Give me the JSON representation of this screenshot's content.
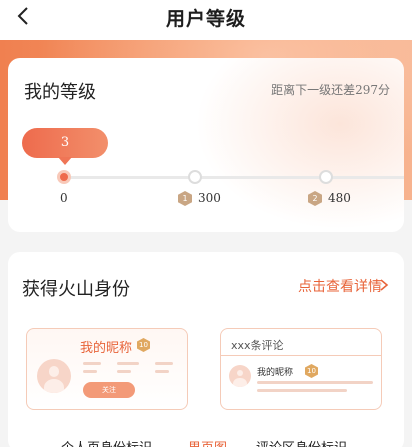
{
  "header": {
    "title": "用户等级"
  },
  "level_card": {
    "title": "我的等级",
    "gap_text": "距离下一级还差297分",
    "current_level": "3",
    "milestones": [
      {
        "value": "0",
        "badge": ""
      },
      {
        "value": "300",
        "badge": "1"
      },
      {
        "value": "480",
        "badge": "2"
      }
    ]
  },
  "identity_card": {
    "title": "获得火山身份",
    "detail_link": "点击查看详情",
    "profile_sample": {
      "nickname": "我的昵称",
      "badge": "10",
      "follow": "关注"
    },
    "comment_sample": {
      "title": "xxx条评论",
      "nickname": "我的昵称",
      "badge": "10"
    },
    "labels": [
      "个人页身份标识",
      "男页图",
      "评论区身份标识"
    ]
  },
  "colors": {
    "accent": "#ee6b4d",
    "link": "#e8643a",
    "badge": "#c9a684"
  }
}
